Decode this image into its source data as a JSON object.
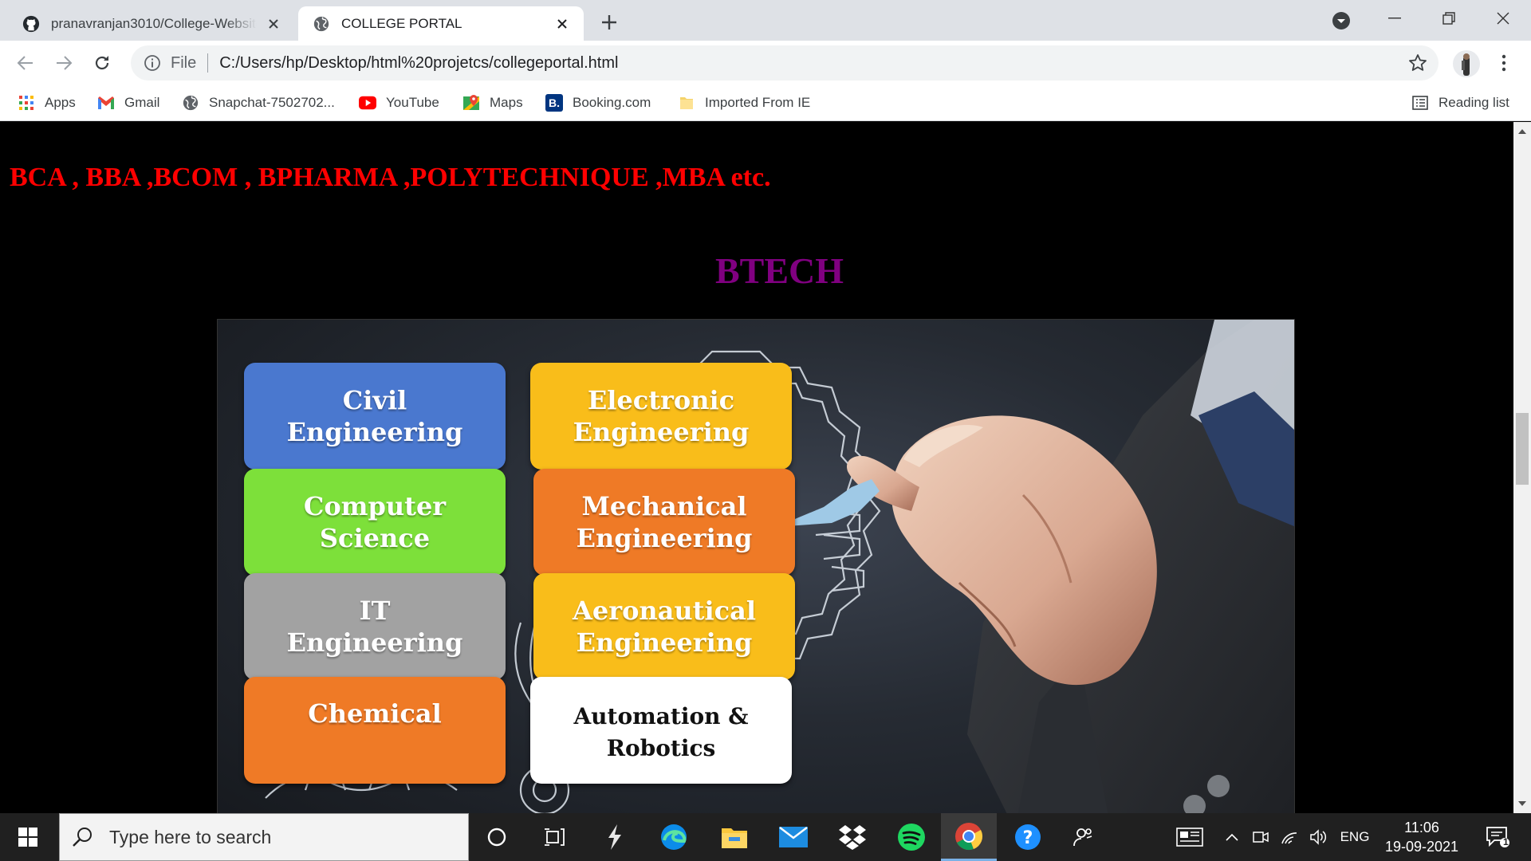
{
  "browser": {
    "tabs": [
      {
        "title": "pranavranjan3010/College-Website",
        "favicon": "github-icon"
      },
      {
        "title": "COLLEGE PORTAL",
        "favicon": "globe-icon",
        "active": true
      }
    ],
    "address": {
      "scheme": "File",
      "url": "C:/Users/hp/Desktop/html%20projetcs/collegeportal.html"
    },
    "bookmarks": [
      {
        "label": "Apps",
        "icon": "apps-grid-icon"
      },
      {
        "label": "Gmail",
        "icon": "gmail-icon"
      },
      {
        "label": "Snapchat-7502702...",
        "icon": "globe-icon"
      },
      {
        "label": "YouTube",
        "icon": "youtube-icon"
      },
      {
        "label": "Maps",
        "icon": "maps-icon"
      },
      {
        "label": "Booking.com",
        "icon": "booking-icon",
        "badge": "B."
      },
      {
        "label": "Imported From IE",
        "icon": "folder-icon"
      }
    ],
    "reading_list": "Reading list"
  },
  "page": {
    "courses_line": "BCA , BBA ,BCOM , BPHARMA ,POLYTECHNIQUE ,MBA etc.",
    "heading": "BTECH",
    "colors": {
      "courses": "#ff0000",
      "heading": "#800080",
      "background": "#000000"
    },
    "branches": [
      {
        "label": "Civil\nEngineering",
        "color": "#4a78cf"
      },
      {
        "label": "Electronic\nEngineering",
        "color": "#f9bd1a"
      },
      {
        "label": "Computer\nScience",
        "color": "#7de03a"
      },
      {
        "label": "Mechanical\nEngineering",
        "color": "#ef7a26"
      },
      {
        "label": "IT\nEngineering",
        "color": "#a2a2a2"
      },
      {
        "label": "Aeronautical\nEngineering",
        "color": "#f9bd1a"
      },
      {
        "label": "Chemical",
        "color": "#ef7a26"
      },
      {
        "label": "Automation & Robotics",
        "color": "#ffffff"
      }
    ]
  },
  "taskbar": {
    "search_placeholder": "Type here to search",
    "apps": [
      "cortana-icon",
      "task-view-icon",
      "app-bolt-icon",
      "edge-icon",
      "file-explorer-icon",
      "mail-icon",
      "dropbox-icon",
      "spotify-icon",
      "chrome-icon",
      "help-icon",
      "people-icon"
    ],
    "language": "ENG",
    "time": "11:06",
    "date": "19-09-2021",
    "notifications": "1"
  }
}
